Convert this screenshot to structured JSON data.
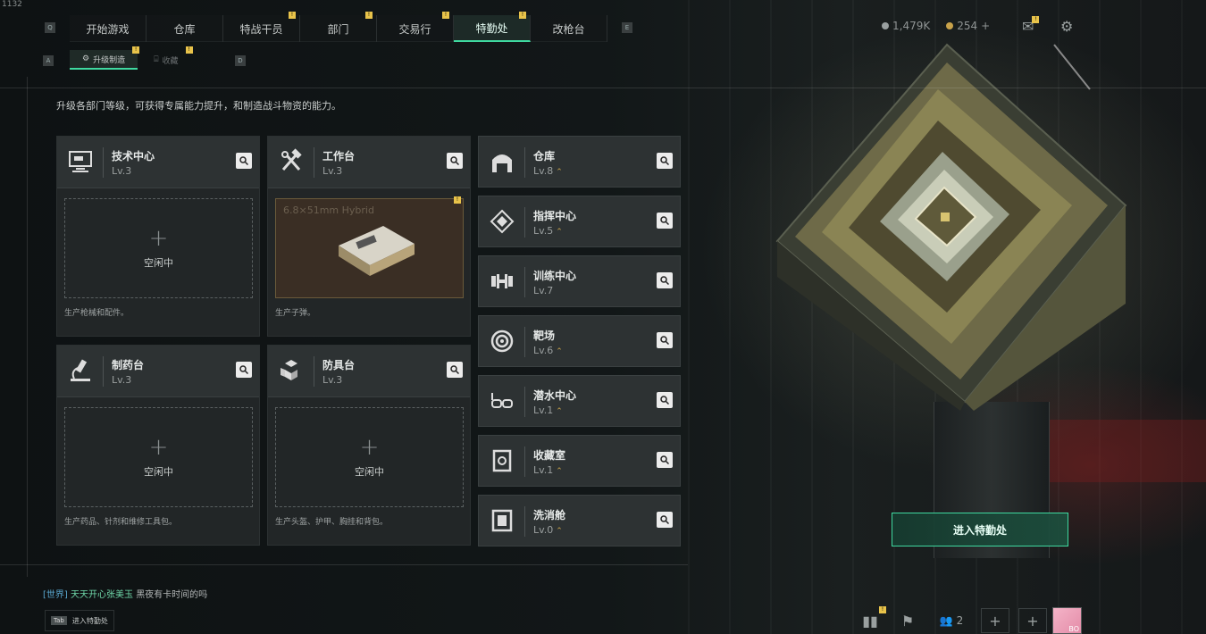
{
  "version": "1132",
  "nav": {
    "key_left": "Q",
    "key_right": "E",
    "tabs": [
      {
        "label": "开始游戏",
        "badge": false,
        "active": false
      },
      {
        "label": "仓库",
        "badge": false,
        "active": false
      },
      {
        "label": "特战干员",
        "badge": true,
        "active": false
      },
      {
        "label": "部门",
        "badge": true,
        "active": false
      },
      {
        "label": "交易行",
        "badge": true,
        "active": false
      },
      {
        "label": "特勤处",
        "badge": true,
        "active": true
      },
      {
        "label": "改枪台",
        "badge": false,
        "active": false
      }
    ]
  },
  "subnav": {
    "key_left": "A",
    "key_right": "D",
    "tabs": [
      {
        "label": "升级制造",
        "active": true,
        "badge": true
      },
      {
        "label": "收藏",
        "active": false,
        "badge": true
      }
    ]
  },
  "resources": {
    "currency1": "1,479K",
    "currency2": "254",
    "add_label": "+"
  },
  "description": "升级各部门等级，可获得专属能力提升，和制造战斗物资的能力。",
  "production_cards": [
    {
      "title": "技术中心",
      "level": "Lv.3",
      "state": "idle",
      "idle_label": "空闲中",
      "footer": "生产枪械和配件。"
    },
    {
      "title": "工作台",
      "level": "Lv.3",
      "state": "producing",
      "product": "6.8×51mm Hybrid",
      "footer": "生产子弹。"
    },
    {
      "title": "制药台",
      "level": "Lv.3",
      "state": "idle",
      "idle_label": "空闲中",
      "footer": "生产药品、针剂和维修工具包。"
    },
    {
      "title": "防具台",
      "level": "Lv.3",
      "state": "idle",
      "idle_label": "空闲中",
      "footer": "生产头盔、护甲、胸挂和背包。"
    }
  ],
  "departments": [
    {
      "title": "仓库",
      "level": "Lv.8",
      "upgradable": true,
      "icon": "warehouse-icon"
    },
    {
      "title": "指挥中心",
      "level": "Lv.5",
      "upgradable": true,
      "icon": "command-center-icon"
    },
    {
      "title": "训练中心",
      "level": "Lv.7",
      "upgradable": false,
      "icon": "dumbbell-icon"
    },
    {
      "title": "靶场",
      "level": "Lv.6",
      "upgradable": true,
      "icon": "target-icon"
    },
    {
      "title": "潜水中心",
      "level": "Lv.1",
      "upgradable": true,
      "icon": "diving-mask-icon"
    },
    {
      "title": "收藏室",
      "level": "Lv.1",
      "upgradable": true,
      "icon": "collection-room-icon"
    },
    {
      "title": "洗消舱",
      "level": "Lv.0",
      "upgradable": true,
      "icon": "decon-chamber-icon"
    }
  ],
  "enter_button": "进入特勤处",
  "chat": {
    "channel": "[世界]",
    "user": "天天开心张美玉",
    "message": "黑夜有卡时间的吗"
  },
  "tab_hint": {
    "key": "Tab",
    "label": "进入特勤处"
  },
  "social": {
    "friends_count": "2",
    "avatar_label": "BO"
  },
  "colors": {
    "accent": "#3fd9a0",
    "badge": "#e8c34a",
    "upgrade": "#c9a44a"
  }
}
